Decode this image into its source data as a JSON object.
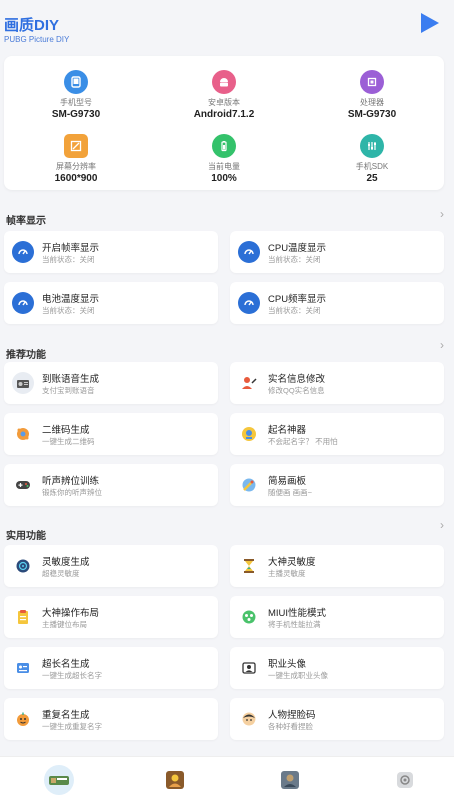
{
  "header": {
    "title": "画质DIY",
    "subtitle": "PUBG Picture DIY"
  },
  "device_info": [
    {
      "label": "手机型号",
      "value": "SM-G9730",
      "icon": "phone-icon",
      "color": "#3a8ee6"
    },
    {
      "label": "安卓版本",
      "value": "Android7.1.2",
      "icon": "android-icon",
      "color": "#e8608a"
    },
    {
      "label": "处理器",
      "value": "SM-G9730",
      "icon": "chip-icon",
      "color": "#9b5fd6"
    },
    {
      "label": "屏幕分辨率",
      "value": "1600*900",
      "icon": "resolution-icon",
      "color": "#f2a23a"
    },
    {
      "label": "当前电量",
      "value": "100%",
      "icon": "battery-icon",
      "color": "#34c26b"
    },
    {
      "label": "手机SDK",
      "value": "25",
      "icon": "sdk-icon",
      "color": "#2eb5a8"
    }
  ],
  "sections": [
    {
      "title": "帧率显示",
      "items": [
        {
          "title": "开启帧率显示",
          "subtitle": "当前状态：关闭",
          "icon": "dashboard-icon"
        },
        {
          "title": "CPU温度显示",
          "subtitle": "当前状态：关闭",
          "icon": "dashboard-icon"
        },
        {
          "title": "电池温度显示",
          "subtitle": "当前状态：关闭",
          "icon": "dashboard-icon"
        },
        {
          "title": "CPU频率显示",
          "subtitle": "当前状态：关闭",
          "icon": "dashboard-icon"
        }
      ]
    },
    {
      "title": "推荐功能",
      "items": [
        {
          "title": "到账语音生成",
          "subtitle": "支付宝到账语音",
          "icon": "radio-icon"
        },
        {
          "title": "实名信息修改",
          "subtitle": "修改QQ实名信息",
          "icon": "person-edit-icon"
        },
        {
          "title": "二维码生成",
          "subtitle": "一键生成二维码",
          "icon": "qrcode-icon"
        },
        {
          "title": "起名神器",
          "subtitle": "不会起名字？ 不用怕",
          "icon": "name-icon"
        },
        {
          "title": "听声辨位训练",
          "subtitle": "锻炼你的听声辨位",
          "icon": "gamepad-icon"
        },
        {
          "title": "简易画板",
          "subtitle": "随便画 画画~",
          "icon": "paint-icon"
        }
      ]
    },
    {
      "title": "实用功能",
      "items": [
        {
          "title": "灵敏度生成",
          "subtitle": "超稳灵敏度",
          "icon": "target-icon"
        },
        {
          "title": "大神灵敏度",
          "subtitle": "主播灵敏度",
          "icon": "hourglass-icon"
        },
        {
          "title": "大神操作布局",
          "subtitle": "主播键位布局",
          "icon": "layout-icon"
        },
        {
          "title": "MIUI性能模式",
          "subtitle": "将手机性能拉满",
          "icon": "performance-icon"
        },
        {
          "title": "超长名生成",
          "subtitle": "一键生成超长名字",
          "icon": "long-name-icon"
        },
        {
          "title": "职业头像",
          "subtitle": "一键生成职业头像",
          "icon": "avatar-icon"
        },
        {
          "title": "重复名生成",
          "subtitle": "一键生成重复名字",
          "icon": "repeat-name-icon"
        },
        {
          "title": "人物捏脸码",
          "subtitle": "各种好看捏脸",
          "icon": "face-icon"
        }
      ]
    }
  ],
  "bottom_nav": [
    {
      "icon": "home-game-icon",
      "active": true
    },
    {
      "icon": "character-icon",
      "active": false
    },
    {
      "icon": "pubg-icon",
      "active": false
    },
    {
      "icon": "settings-icon",
      "active": false
    }
  ]
}
